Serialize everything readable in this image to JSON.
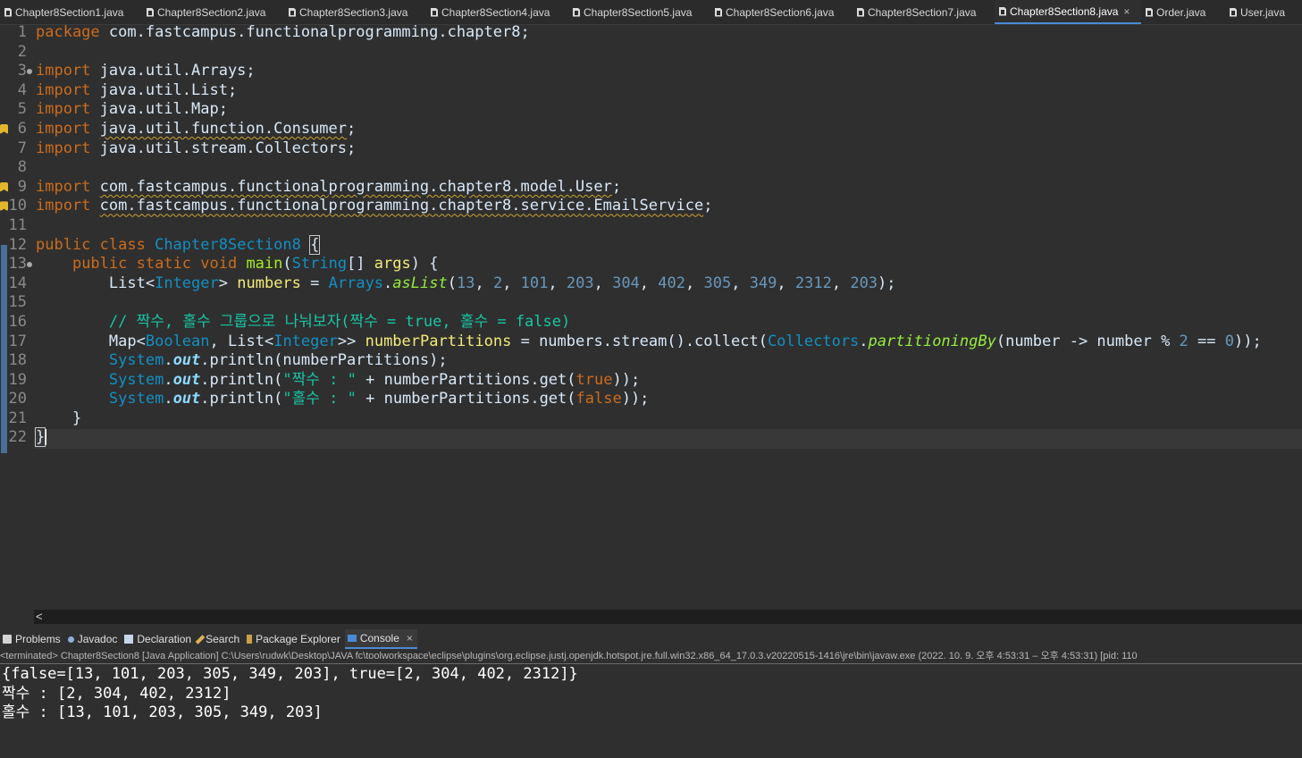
{
  "editor_tabs": [
    {
      "label": "Chapter8Section1.java",
      "active": false,
      "icon": "java-file-icon"
    },
    {
      "label": "Chapter8Section2.java",
      "active": false,
      "icon": "java-file-icon"
    },
    {
      "label": "Chapter8Section3.java",
      "active": false,
      "icon": "java-file-icon"
    },
    {
      "label": "Chapter8Section4.java",
      "active": false,
      "icon": "java-file-icon"
    },
    {
      "label": "Chapter8Section5.java",
      "active": false,
      "icon": "java-file-icon"
    },
    {
      "label": "Chapter8Section6.java",
      "active": false,
      "icon": "java-file-icon"
    },
    {
      "label": "Chapter8Section7.java",
      "active": false,
      "icon": "java-file-icon"
    },
    {
      "label": "Chapter8Section8.java",
      "active": true,
      "icon": "java-file-icon",
      "close": "×"
    },
    {
      "label": "Order.java",
      "active": false,
      "icon": "java-file-icon"
    },
    {
      "label": "User.java",
      "active": false,
      "icon": "java-file-icon"
    }
  ],
  "code": {
    "line_numbers": [
      "1",
      "2",
      "3",
      "4",
      "5",
      "6",
      "7",
      "8",
      "9",
      "10",
      "11",
      "12",
      "13",
      "14",
      "15",
      "16",
      "17",
      "18",
      "19",
      "20",
      "21",
      "22"
    ],
    "l1": {
      "kw": "package",
      "rest": " com.fastcampus.functionalprogramming.chapter8;"
    },
    "l3": {
      "kw": "import",
      "rest": " java.util.Arrays;"
    },
    "l4": {
      "kw": "import",
      "rest": " java.util.List;"
    },
    "l5": {
      "kw": "import",
      "rest": " java.util.Map;"
    },
    "l6": {
      "kw": "import",
      "sp": " ",
      "path": "java.util.function.Consumer",
      "semi": ";"
    },
    "l7": {
      "kw": "import",
      "rest": " java.util.stream.Collectors;"
    },
    "l9": {
      "kw": "import",
      "sp": " ",
      "path": "com.fastcampus.functionalprogramming.chapter8.model.User",
      "semi": ";"
    },
    "l10": {
      "kw": "import",
      "sp": " ",
      "path": "com.fastcampus.functionalprogramming.chapter8.service.EmailService",
      "semi": ";"
    },
    "l12": {
      "kw": "public class",
      "name": "Chapter8Section8",
      "brace": "{"
    },
    "l13": {
      "indent": "    ",
      "kw": "public static void",
      "meth": "main",
      "p1": "(",
      "type": "String",
      "p2": "[] ",
      "arg": "args",
      "p3": ") {"
    },
    "l14": {
      "indent": "        ",
      "t1": "List",
      "lt": "<",
      "t2": "Integer",
      "gt": ">",
      "sp": " ",
      "var": "numbers",
      "eq": " = ",
      "cls": "Arrays",
      "dot": ".",
      "sm": "asList",
      "args": [
        "13",
        "2",
        "101",
        "203",
        "304",
        "402",
        "305",
        "349",
        "2312",
        "203"
      ]
    },
    "l16": {
      "indent": "        ",
      "comment": "// 짝수, 홀수 그룹으로 나눠보자(짝수 = true, 홀수 = false)"
    },
    "l17": {
      "indent": "        ",
      "t1": "Map",
      "lt": "<",
      "t2": "Boolean",
      "c": ", ",
      "t3": "List",
      "lt2": "<",
      "t4": "Integer",
      "gt": ">>",
      "sp": " ",
      "var": "numberPartitions",
      "eq": " = numbers.stream().collect(",
      "cls": "Collectors",
      "dot": ".",
      "sm": "partitioningBy",
      "p1": "(number -> number % ",
      "n1": "2",
      "p2": " == ",
      "n2": "0",
      "p3": "));"
    },
    "l18": {
      "indent": "        ",
      "cls": "System",
      "dot": ".",
      "fld": "out",
      "rest": ".println(numberPartitions);"
    },
    "l19": {
      "indent": "        ",
      "cls": "System",
      "dot": ".",
      "fld": "out",
      "p1": ".println(",
      "str": "\"짝수 : \"",
      "p2": " + numberPartitions.get(",
      "bool": "true",
      "p3": "));"
    },
    "l20": {
      "indent": "        ",
      "cls": "System",
      "dot": ".",
      "fld": "out",
      "p1": ".println(",
      "str": "\"홀수 : \"",
      "p2": " + numberPartitions.get(",
      "bool": "false",
      "p3": "));"
    },
    "l21": {
      "text": "    }"
    },
    "l22": {
      "text": "}"
    }
  },
  "bottom_tabs": [
    {
      "label": "Problems",
      "icon": "problems-icon",
      "active": false
    },
    {
      "label": "Javadoc",
      "icon": "javadoc-icon",
      "active": false
    },
    {
      "label": "Declaration",
      "icon": "declaration-icon",
      "active": false
    },
    {
      "label": "Search",
      "icon": "search-icon",
      "active": false
    },
    {
      "label": "Package Explorer",
      "icon": "package-explorer-icon",
      "active": false
    },
    {
      "label": "Console",
      "icon": "console-icon",
      "active": true,
      "close": "×"
    }
  ],
  "console": {
    "description": "<terminated> Chapter8Section8 [Java Application] C:\\Users\\rudwk\\Desktop\\JAVA fc\\toolworkspace\\eclipse\\plugins\\org.eclipse.justj.openjdk.hotspot.jre.full.win32.x86_64_17.0.3.v20220515-1416\\jre\\bin\\javaw.exe  (2022. 10. 9. 오후 4:53:31 – 오후 4:53:31) [pid: 110",
    "output": [
      "{false=[13, 101, 203, 305, 349, 203], true=[2, 304, 402, 2312]}",
      "짝수 : [2, 304, 402, 2312]",
      "홀수 : [13, 101, 203, 305, 349, 203]"
    ]
  },
  "scroll": {
    "left_arrow": "<"
  },
  "colors": {
    "keyword": "#cc6c1d",
    "type": "#1290c3",
    "variable": "#f3ec79",
    "number": "#6897bb",
    "string": "#17c6a3",
    "accent": "#4a8ad4"
  }
}
